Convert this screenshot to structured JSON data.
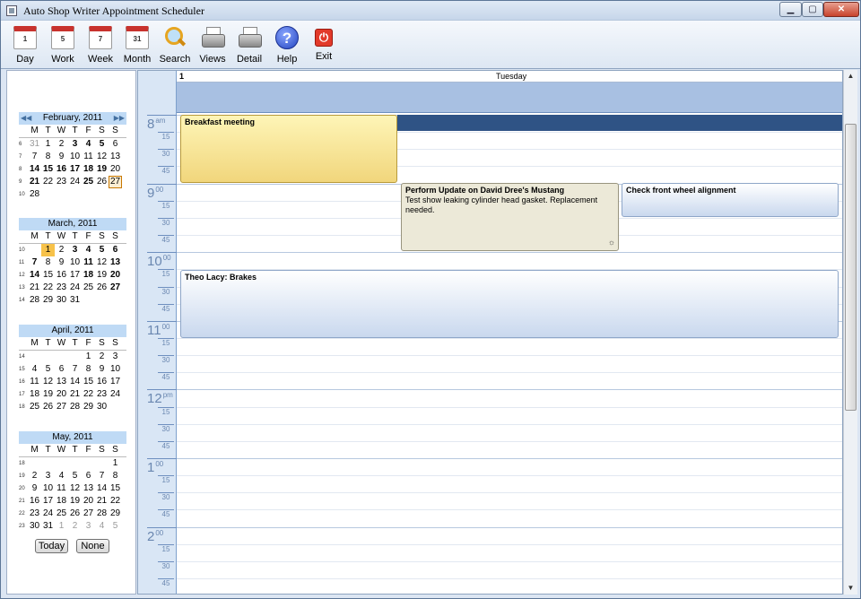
{
  "window": {
    "title": "Auto Shop Writer Appointment Scheduler",
    "min": "▁",
    "max": "▢",
    "close": "✕"
  },
  "toolbar": [
    {
      "label": "Day",
      "icon": "calendar-day-icon",
      "glyph": "1"
    },
    {
      "label": "Work",
      "icon": "calendar-work-icon",
      "glyph": "5"
    },
    {
      "label": "Week",
      "icon": "calendar-week-icon",
      "glyph": "7"
    },
    {
      "label": "Month",
      "icon": "calendar-month-icon",
      "glyph": "31"
    },
    {
      "label": "Search",
      "icon": "search-icon"
    },
    {
      "label": "Views",
      "icon": "printer-icon"
    },
    {
      "label": "Detail",
      "icon": "printer-icon"
    },
    {
      "label": "Help",
      "icon": "help-icon",
      "glyph": "?"
    },
    {
      "label": "Exit",
      "icon": "power-icon",
      "glyph": "⏻"
    }
  ],
  "weekday_headers": [
    "M",
    "T",
    "W",
    "T",
    "F",
    "S",
    "S"
  ],
  "months": [
    {
      "title": "February, 2011",
      "nav_prev": "◀◀",
      "nav_next": "▶▶",
      "weeks": [
        {
          "wk": "6",
          "days": [
            "31",
            "1",
            "2",
            "3",
            "4",
            "5",
            "6"
          ],
          "grey": [
            0
          ],
          "bold": [
            3,
            4,
            5
          ]
        },
        {
          "wk": "7",
          "days": [
            "7",
            "8",
            "9",
            "10",
            "11",
            "12",
            "13"
          ],
          "grey": [],
          "bold": []
        },
        {
          "wk": "8",
          "days": [
            "14",
            "15",
            "16",
            "17",
            "18",
            "19",
            "20"
          ],
          "grey": [],
          "bold": [
            0,
            1,
            2,
            3,
            4,
            5
          ]
        },
        {
          "wk": "9",
          "days": [
            "21",
            "22",
            "23",
            "24",
            "25",
            "26",
            "27"
          ],
          "grey": [],
          "bold": [
            0,
            4
          ],
          "today": 6
        },
        {
          "wk": "10",
          "days": [
            "28",
            "",
            "",
            "",
            "",
            "",
            ""
          ],
          "grey": [],
          "bold": []
        }
      ]
    },
    {
      "title": "March, 2011",
      "weeks": [
        {
          "wk": "10",
          "days": [
            "",
            "1",
            "2",
            "3",
            "4",
            "5",
            "6"
          ],
          "grey": [],
          "bold": [
            3,
            4,
            5,
            6
          ],
          "sel": 1
        },
        {
          "wk": "11",
          "days": [
            "7",
            "8",
            "9",
            "10",
            "11",
            "12",
            "13"
          ],
          "grey": [],
          "bold": [
            0,
            4,
            6
          ]
        },
        {
          "wk": "12",
          "days": [
            "14",
            "15",
            "16",
            "17",
            "18",
            "19",
            "20"
          ],
          "grey": [],
          "bold": [
            0,
            4,
            6
          ]
        },
        {
          "wk": "13",
          "days": [
            "21",
            "22",
            "23",
            "24",
            "25",
            "26",
            "27"
          ],
          "grey": [],
          "bold": [
            6
          ]
        },
        {
          "wk": "14",
          "days": [
            "28",
            "29",
            "30",
            "31",
            "",
            "",
            ""
          ],
          "grey": [],
          "bold": []
        }
      ]
    },
    {
      "title": "April, 2011",
      "weeks": [
        {
          "wk": "14",
          "days": [
            "",
            "",
            "",
            "",
            "1",
            "2",
            "3"
          ],
          "grey": [],
          "bold": []
        },
        {
          "wk": "15",
          "days": [
            "4",
            "5",
            "6",
            "7",
            "8",
            "9",
            "10"
          ],
          "grey": [],
          "bold": []
        },
        {
          "wk": "16",
          "days": [
            "11",
            "12",
            "13",
            "14",
            "15",
            "16",
            "17"
          ],
          "grey": [],
          "bold": []
        },
        {
          "wk": "17",
          "days": [
            "18",
            "19",
            "20",
            "21",
            "22",
            "23",
            "24"
          ],
          "grey": [],
          "bold": []
        },
        {
          "wk": "18",
          "days": [
            "25",
            "26",
            "27",
            "28",
            "29",
            "30",
            ""
          ],
          "grey": [],
          "bold": []
        }
      ]
    },
    {
      "title": "May, 2011",
      "weeks": [
        {
          "wk": "18",
          "days": [
            "",
            "",
            "",
            "",
            "",
            "",
            "1"
          ],
          "grey": [],
          "bold": []
        },
        {
          "wk": "19",
          "days": [
            "2",
            "3",
            "4",
            "5",
            "6",
            "7",
            "8"
          ],
          "grey": [],
          "bold": []
        },
        {
          "wk": "20",
          "days": [
            "9",
            "10",
            "11",
            "12",
            "13",
            "14",
            "15"
          ],
          "grey": [],
          "bold": []
        },
        {
          "wk": "21",
          "days": [
            "16",
            "17",
            "18",
            "19",
            "20",
            "21",
            "22"
          ],
          "grey": [],
          "bold": []
        },
        {
          "wk": "22",
          "days": [
            "23",
            "24",
            "25",
            "26",
            "27",
            "28",
            "29"
          ],
          "grey": [],
          "bold": []
        },
        {
          "wk": "23",
          "days": [
            "30",
            "31",
            "1",
            "2",
            "3",
            "4",
            "5"
          ],
          "grey": [
            2,
            3,
            4,
            5,
            6
          ],
          "bold": []
        }
      ]
    }
  ],
  "today_button": "Today",
  "none_button": "None",
  "day_header": {
    "number": "1",
    "name": "Tuesday"
  },
  "hours": [
    {
      "h": "8",
      "s": "am"
    },
    {
      "h": "9",
      "s": "00"
    },
    {
      "h": "10",
      "s": "00"
    },
    {
      "h": "11",
      "s": "00"
    },
    {
      "h": "12",
      "s": "pm"
    },
    {
      "h": "1",
      "s": "00"
    },
    {
      "h": "2",
      "s": "00"
    }
  ],
  "quarters": [
    "15",
    "30",
    "45"
  ],
  "appointments": {
    "a1": {
      "title": "Breakfast meeting",
      "body": ""
    },
    "a2": {
      "title": "Perform Update on David Dree's Mustang",
      "body": "Test show leaking cylinder head gasket.  Replacement needed."
    },
    "a3": {
      "title": "Check front wheel alignment",
      "body": ""
    },
    "a4": {
      "title": "Theo Lacy: Brakes",
      "body": ""
    }
  },
  "scroll": {
    "up": "▲",
    "down": "▼"
  }
}
